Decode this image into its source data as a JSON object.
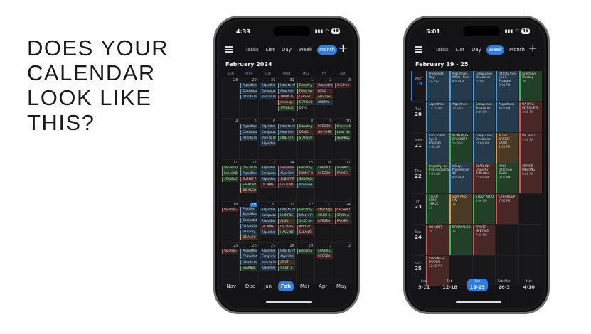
{
  "headline": [
    "DOES YOUR",
    "CALENDAR",
    "LOOK LIKE",
    "THIS?"
  ],
  "phone1": {
    "time": "4:33",
    "battery": "48",
    "tabs": [
      "Tasks",
      "List",
      "Day",
      "Week",
      "Month"
    ],
    "active_tab": "Month",
    "title": "February 2024",
    "dow": [
      "Sun",
      "Mon",
      "Tue",
      "Wed",
      "Thu",
      "Fri",
      "Sat"
    ],
    "weeks": [
      [
        {
          "d": "28",
          "ev": []
        },
        {
          "d": "29",
          "ev": [
            {
              "t": "Algorithm",
              "c": "#4aa0e0"
            },
            {
              "t": "Computat",
              "c": "#4aa0e0"
            },
            {
              "t": "Intro to Inf",
              "c": "#4aa0e0"
            }
          ]
        },
        {
          "d": "30",
          "ev": [
            {
              "t": "Algorithm",
              "c": "#4aa0e0"
            },
            {
              "t": "Computat",
              "c": "#4aa0e0"
            },
            {
              "t": "Intro to Inf",
              "c": "#4aa0e0"
            }
          ]
        },
        {
          "d": "31",
          "ev": [
            {
              "t": "Intro to Inf",
              "c": "#4aa0e0"
            },
            {
              "t": "Algorithm",
              "c": "#4aa0e0"
            },
            {
              "t": "TRADE IT",
              "c": "#d9534f"
            },
            {
              "t": "meet up",
              "c": "#e0a040"
            },
            {
              "t": "STARBUC",
              "c": "#3fb950"
            }
          ]
        },
        {
          "d": "1",
          "ev": [
            {
              "t": "Empathy",
              "c": "#3fb950"
            },
            {
              "t": "Finish up",
              "c": "#e0a040"
            },
            {
              "t": "LABS HC",
              "c": "#d9534f"
            },
            {
              "t": "STARBUC",
              "c": "#3fb950"
            },
            {
              "t": "DEVO",
              "c": "#888"
            }
          ]
        },
        {
          "d": "2",
          "ev": [
            {
              "t": "Ground ho",
              "c": "#d86aa0"
            },
            {
              "t": "DEVO",
              "c": "#d9534f"
            },
            {
              "t": "ALGO ex",
              "c": "#e0a040"
            },
            {
              "t": "UPDP fo",
              "c": "#4aa0e0"
            }
          ]
        },
        {
          "d": "3",
          "ev": [
            {
              "t": "ALGO ex",
              "c": "#d9534f"
            }
          ]
        }
      ],
      [
        {
          "d": "4",
          "ev": []
        },
        {
          "d": "5",
          "ev": [
            {
              "t": "Algorithm",
              "c": "#4aa0e0"
            },
            {
              "t": "Computat",
              "c": "#4aa0e0"
            },
            {
              "t": "Intro to Inf",
              "c": "#4aa0e0"
            }
          ]
        },
        {
          "d": "6",
          "ev": [
            {
              "t": "Algorithm",
              "c": "#4aa0e0"
            },
            {
              "t": "Computat",
              "c": "#4aa0e0"
            },
            {
              "t": "Intro to Inf",
              "c": "#4aa0e0"
            },
            {
              "t": "Algorithm",
              "c": "#4aa0e0"
            }
          ]
        },
        {
          "d": "7",
          "ev": [
            {
              "t": "Intro to Inf",
              "c": "#4aa0e0"
            },
            {
              "t": "Algorithm",
              "c": "#4aa0e0"
            },
            {
              "t": "FIND STA",
              "c": "#3fb950"
            }
          ]
        },
        {
          "d": "8",
          "ev": [
            {
              "t": "Empathy",
              "c": "#3fb950"
            },
            {
              "t": "DEADL",
              "c": "#d9534f"
            },
            {
              "t": "STARBUC",
              "c": "#3fb950"
            }
          ]
        },
        {
          "d": "9",
          "ev": [
            {
              "t": "LIFEGRO",
              "c": "#d9534f"
            },
            {
              "t": "DO COMP",
              "c": "#d9534f"
            }
          ]
        },
        {
          "d": "10",
          "ev": [
            {
              "t": "Chinese N",
              "c": "#3fb950"
            },
            {
              "t": "Lunar Ne",
              "c": "#3fb950"
            },
            {
              "t": "STARBUC",
              "c": "#3fb950"
            }
          ]
        }
      ],
      [
        {
          "d": "11",
          "ev": [
            {
              "t": "Second D",
              "c": "#3fb950"
            },
            {
              "t": "Second D",
              "c": "#3fb950"
            },
            {
              "t": "STARBUC",
              "c": "#3fb950"
            }
          ]
        },
        {
          "d": "12",
          "ev": [
            {
              "t": "Day off fo",
              "c": "#3fb950"
            },
            {
              "t": "Algorithm",
              "c": "#4aa0e0"
            },
            {
              "t": "SUBMIT P",
              "c": "#d9534f"
            },
            {
              "t": "START PR",
              "c": "#3fb950"
            },
            {
              "t": "DO ALGO",
              "c": "#e0a040"
            }
          ]
        },
        {
          "d": "13",
          "ev": [
            {
              "t": "Algorithm",
              "c": "#4aa0e0"
            },
            {
              "t": "Computat",
              "c": "#4aa0e0"
            },
            {
              "t": "Algorithm",
              "c": "#4aa0e0"
            },
            {
              "t": "UA PARE",
              "c": "#d9534f"
            }
          ]
        },
        {
          "d": "14",
          "ev": [
            {
              "t": "Valentine",
              "c": "#d86aa0"
            },
            {
              "t": "Algorithm",
              "c": "#4aa0e0"
            },
            {
              "t": "SUBMIT R",
              "c": "#d9534f"
            },
            {
              "t": "DO TOPIC",
              "c": "#d9534f"
            }
          ]
        },
        {
          "d": "15",
          "ev": [
            {
              "t": "Empathy",
              "c": "#3fb950"
            },
            {
              "t": "SUBMIT R",
              "c": "#d9534f"
            },
            {
              "t": "SORAMOI",
              "c": "#3fb950"
            },
            {
              "t": "Interview",
              "c": "#4aa0e0"
            }
          ]
        },
        {
          "d": "16",
          "ev": [
            {
              "t": "STARBUC",
              "c": "#3fb950"
            },
            {
              "t": "LIFEGRO",
              "c": "#d9534f"
            }
          ]
        },
        {
          "d": "17",
          "ev": [
            {
              "t": "STARBUC",
              "c": "#3fb950"
            },
            {
              "t": "PRAYER",
              "c": "#d9534f"
            }
          ]
        }
      ],
      [
        {
          "d": "18",
          "ev": [
            {
              "t": "SERVING",
              "c": "#d9534f"
            }
          ]
        },
        {
          "d": "19",
          "today": true,
          "ev": [
            {
              "t": "Presiden",
              "c": "#4aa0e0"
            },
            {
              "t": "Algorithm",
              "c": "#4aa0e0"
            },
            {
              "t": "Computat",
              "c": "#4aa0e0"
            },
            {
              "t": "Intro to Inf",
              "c": "#4aa0e0"
            },
            {
              "t": "ID Infosy",
              "c": "#4aa0e0"
            },
            {
              "t": "DE ALGO",
              "c": "#e0a040"
            }
          ]
        },
        {
          "d": "20",
          "ev": [
            {
              "t": "Algorithm",
              "c": "#4aa0e0"
            },
            {
              "t": "Computat",
              "c": "#4aa0e0"
            },
            {
              "t": "Algorithm",
              "c": "#4aa0e0"
            },
            {
              "t": "UA PARE",
              "c": "#d9534f"
            },
            {
              "t": "Algorithm",
              "c": "#4aa0e0"
            }
          ]
        },
        {
          "d": "21",
          "ev": [
            {
              "t": "Intro to Inf",
              "c": "#4aa0e0"
            },
            {
              "t": "ID INFOS",
              "c": "#3fb950"
            },
            {
              "t": "ALGO",
              "c": "#e0a040"
            },
            {
              "t": "OH SHIFT",
              "c": "#d9534f"
            },
            {
              "t": "HASS INT",
              "c": "#3fb950"
            }
          ]
        },
        {
          "d": "22",
          "ev": [
            {
              "t": "Empathy",
              "c": "#3fb950"
            },
            {
              "t": "Infosys Pr",
              "c": "#4aa0e0"
            },
            {
              "t": "14:55 re",
              "c": "#3fb950"
            },
            {
              "t": "PRAYER",
              "c": "#d9534f"
            },
            {
              "t": "SALANTI",
              "c": "#d9534f"
            }
          ]
        },
        {
          "d": "23",
          "ev": [
            {
              "t": "Start Algo",
              "c": "#e0a040"
            },
            {
              "t": "STUDY A",
              "c": "#3fb950"
            },
            {
              "t": "LIFEGRO",
              "c": "#d9534f"
            }
          ]
        },
        {
          "d": "24",
          "ev": [
            {
              "t": "OH SHIFT",
              "c": "#d9534f"
            },
            {
              "t": "STUDY A",
              "c": "#3fb950"
            },
            {
              "t": "PRAYER",
              "c": "#d9534f"
            }
          ]
        }
      ],
      [
        {
          "d": "25",
          "ev": [
            {
              "t": "SERVING",
              "c": "#d9534f"
            }
          ]
        },
        {
          "d": "26",
          "ev": [
            {
              "t": "Algorithm",
              "c": "#4aa0e0"
            },
            {
              "t": "Computat",
              "c": "#4aa0e0"
            },
            {
              "t": "Intro to Inf",
              "c": "#4aa0e0"
            },
            {
              "t": "STARBUC",
              "c": "#3fb950"
            }
          ]
        },
        {
          "d": "27",
          "ev": [
            {
              "t": "Algorithm",
              "c": "#4aa0e0"
            },
            {
              "t": "Computat",
              "c": "#4aa0e0"
            },
            {
              "t": "Intro to Inf",
              "c": "#4aa0e0"
            },
            {
              "t": "Algorithm",
              "c": "#4aa0e0"
            }
          ]
        },
        {
          "d": "28",
          "ev": [
            {
              "t": "Intro to Inf",
              "c": "#4aa0e0"
            },
            {
              "t": "Algorithm",
              "c": "#4aa0e0"
            },
            {
              "t": "(TEST)",
              "c": "#e0a040"
            },
            {
              "t": "STUDY C",
              "c": "#3fb950"
            }
          ]
        },
        {
          "d": "29",
          "ev": [
            {
              "t": "Empathy",
              "c": "#3fb950"
            }
          ]
        },
        {
          "d": "1",
          "ev": [
            {
              "t": "STARBUC",
              "c": "#3fb950"
            },
            {
              "t": "LIFEGRO",
              "c": "#d9534f"
            }
          ]
        },
        {
          "d": "2",
          "ev": []
        }
      ]
    ],
    "months": [
      "Nov",
      "Dec",
      "Jan",
      "Feb",
      "Mar",
      "Apr",
      "May"
    ],
    "active_month": "Feb"
  },
  "phone2": {
    "time": "5:01",
    "battery": "46",
    "tabs": [
      "Tasks",
      "List",
      "Day",
      "Week",
      "Month"
    ],
    "active_tab": "Week",
    "title": "February 19 - 25",
    "days": [
      {
        "dow": "Mon",
        "num": "19",
        "today": true,
        "cells": [
          {
            "t": "Presidents' Day",
            "time": "All-day",
            "c": "#4aa0e0"
          },
          {
            "t": "Algorithms Office Hours",
            "time": "9:00 AM",
            "c": "#4aa0e0"
          },
          {
            "t": "Computatio Structures",
            "time": "10:00",
            "c": "#4aa0e0"
          },
          {
            "t": "Intro to Info Sys & Program",
            "time": "2:00 PM",
            "c": "#4aa0e0"
          },
          {
            "t": "ID Infosys Meeting",
            "time": "3h",
            "c": "#3fb950"
          }
        ]
      },
      {
        "dow": "Tue",
        "num": "20",
        "cells": [
          {
            "t": "Algorithms",
            "time": "12:30 PM",
            "c": "#4aa0e0"
          },
          {
            "t": "Algorithms",
            "time": "1h 30m",
            "c": "#4aa0e0"
          },
          {
            "t": "Computatio Structures",
            "time": "2:30 PM",
            "c": "#4aa0e0"
          },
          {
            "t": "Algorithms",
            "time": "4:00 PM",
            "c": "#4aa0e0"
          },
          {
            "t": "UA PARE INTERVIEW",
            "time": "6:00 PM",
            "c": "#d9534f"
          }
        ]
      },
      {
        "dow": "Wed",
        "num": "21",
        "cells": [
          {
            "t": "Intro to Info Sys & Program",
            "time": "9:30 AM",
            "c": "#4aa0e0"
          },
          {
            "t": "ID INFOSYS CHECKOFF",
            "time": "1h 30m",
            "c": "#3fb950"
          },
          {
            "t": "Computatio Structures",
            "time": "11:00 AM",
            "c": "#4aa0e0"
          },
          {
            "t": "ALGO BREEZE EXAM",
            "time": "1:00 PM",
            "c": "#e0a040"
          },
          {
            "t": "OH SHIFT",
            "time": "2:00 PM",
            "c": "#d9534f"
          }
        ]
      },
      {
        "dow": "Thu",
        "num": "22",
        "cells": [
          {
            "t": "Empathy: An Interdisciplinary",
            "time": "9:00 AM",
            "c": "#3fb950"
          },
          {
            "t": "Infosys Problem Set 16",
            "time": "9:00 AM",
            "c": "#4aa0e0"
          },
          {
            "t": "DEADLINE Empathy Reflection",
            "time": "11:00 AM",
            "c": "#d9534f"
          },
          {
            "t": "HASS Interview Guide",
            "time": "3:00 PM",
            "c": "#3fb950"
          },
          {
            "t": "PRAYER MEETING",
            "time": "8:00 PM",
            "c": "#d9534f"
          }
        ]
      },
      {
        "dow": "Fri",
        "num": "23",
        "cells": [
          {
            "t": "STUDY COMP STRUC",
            "time": "3h",
            "c": "#3fb950"
          },
          {
            "t": "Start Algo HW",
            "time": "3h",
            "c": "#e0a040"
          },
          {
            "t": "STUDY ALGO",
            "time": "4:00 PM",
            "c": "#3fb950"
          },
          {
            "t": "LIFEGROUP",
            "time": "7:30 PM",
            "c": "#d9534f"
          },
          {
            "t": "",
            "time": "",
            "c": ""
          }
        ]
      },
      {
        "dow": "Sat",
        "num": "24",
        "cells": [
          {
            "t": "OH SHIFT",
            "time": "3h",
            "c": "#d9534f"
          },
          {
            "t": "STUDY ALGO",
            "time": "3h",
            "c": "#3fb950"
          },
          {
            "t": "PRAYER MEETING",
            "time": "7:00 PM",
            "c": "#d9534f"
          },
          {
            "t": "",
            "time": "",
            "c": ""
          },
          {
            "t": "",
            "time": "",
            "c": ""
          }
        ]
      },
      {
        "dow": "Sun",
        "num": "25",
        "cells": [
          {
            "t": "SERVING + PRAYER",
            "time": "12:30 PM",
            "c": "#d9534f"
          },
          {
            "t": "",
            "time": "",
            "c": ""
          },
          {
            "t": "",
            "time": "",
            "c": ""
          },
          {
            "t": "",
            "time": "",
            "c": ""
          },
          {
            "t": "",
            "time": "",
            "c": ""
          }
        ]
      }
    ],
    "weeks_strip": [
      {
        "m": "Feb",
        "r": "5-11"
      },
      {
        "m": "Feb",
        "r": "12-18"
      },
      {
        "m": "Feb",
        "r": "19-25",
        "active": true
      },
      {
        "m": "Feb-Mar",
        "r": "26-3"
      },
      {
        "m": "Mar",
        "r": "4-10"
      }
    ]
  }
}
